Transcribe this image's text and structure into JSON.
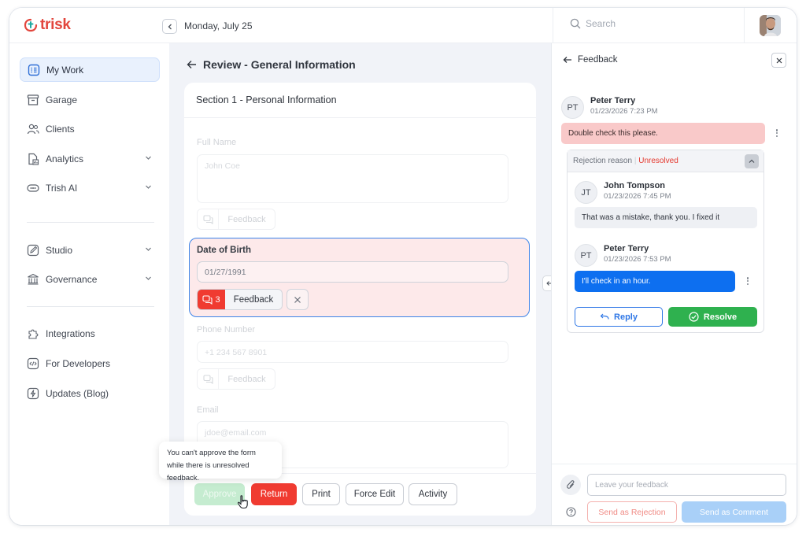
{
  "app": {
    "logo_text": "trisk",
    "brand_color": "#e2463d"
  },
  "topbar": {
    "date": "Monday, July 25",
    "search_placeholder": "Search"
  },
  "sidebar": {
    "items": [
      {
        "label": "My Work",
        "icon": "my-work-icon",
        "active": true
      },
      {
        "label": "Garage",
        "icon": "garage-icon"
      },
      {
        "label": "Clients",
        "icon": "clients-icon"
      },
      {
        "label": "Analytics",
        "icon": "analytics-icon",
        "expandable": true
      },
      {
        "label": "Trish AI",
        "icon": "trish-ai-icon",
        "expandable": true
      },
      {
        "label": "Studio",
        "icon": "studio-icon",
        "expandable": true
      },
      {
        "label": "Governance",
        "icon": "governance-icon",
        "expandable": true
      },
      {
        "label": "Integrations",
        "icon": "integrations-icon"
      },
      {
        "label": "For Developers",
        "icon": "developers-icon"
      },
      {
        "label": "Updates (Blog)",
        "icon": "updates-icon"
      }
    ]
  },
  "main": {
    "title": "Review - General Information",
    "section_title": "Section 1 - Personal Information",
    "fields": {
      "full_name": {
        "label": "Full Name",
        "placeholder": "John Coe",
        "feedback_label": "Feedback"
      },
      "dob": {
        "label": "Date of Birth",
        "value": "01/27/1991",
        "feedback_count": "3",
        "feedback_label": "Feedback"
      },
      "phone": {
        "label": "Phone Number",
        "placeholder": "+1 234 567 8901",
        "feedback_label": "Feedback"
      },
      "email": {
        "label": "Email",
        "placeholder": "jdoe@email.com"
      }
    },
    "tooltip": "You can't approve the form while there is unresolved feedback.",
    "actions": {
      "approve": "Approve",
      "return": "Return",
      "print": "Print",
      "force_edit": "Force Edit",
      "activity": "Activity"
    }
  },
  "feedback": {
    "title": "Feedback",
    "first_comment": {
      "initials": "PT",
      "name": "Peter Terry",
      "time": "01/23/2026  7:23 PM",
      "text": "Double check this please."
    },
    "rejection": {
      "label": "Rejection reason",
      "status": "Unresolved"
    },
    "replies": [
      {
        "initials": "JT",
        "name": "John Tompson",
        "time": "01/23/2026  7:45 PM",
        "text": "That was a mistake, thank you. I fixed it"
      },
      {
        "initials": "PT",
        "name": "Peter Terry",
        "time": "01/23/2026  7:53 PM",
        "text": "I'll check in an hour."
      }
    ],
    "reply_label": "Reply",
    "resolve_label": "Resolve",
    "input_placeholder": "Leave your feedback",
    "send_rejection": "Send as Rejection",
    "send_comment": "Send as Comment"
  }
}
